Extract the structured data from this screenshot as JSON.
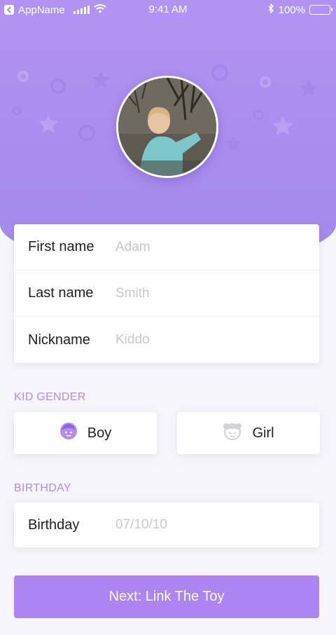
{
  "status_bar": {
    "app_name": "AppName",
    "time": "9:41 AM",
    "battery": "100%"
  },
  "form": {
    "first_name": {
      "label": "First name",
      "placeholder": "Adam"
    },
    "last_name": {
      "label": "Last name",
      "placeholder": "Smith"
    },
    "nickname": {
      "label": "Nickname",
      "placeholder": "Kiddo"
    }
  },
  "gender": {
    "section_label": "KID GENDER",
    "options": [
      {
        "label": "Boy",
        "icon": "boy-face-icon",
        "selected": true
      },
      {
        "label": "Girl",
        "icon": "girl-face-icon",
        "selected": false
      }
    ]
  },
  "birthday": {
    "section_label": "BIRTHDAY",
    "label": "Birthday",
    "placeholder": "07/10/10"
  },
  "next_button": {
    "label": "Next: Link The Toy"
  },
  "colors": {
    "accent": "#ad84f2",
    "header_gradient_top": "#b393f2",
    "section_label": "#b48cec",
    "placeholder": "#c8c8cf"
  }
}
